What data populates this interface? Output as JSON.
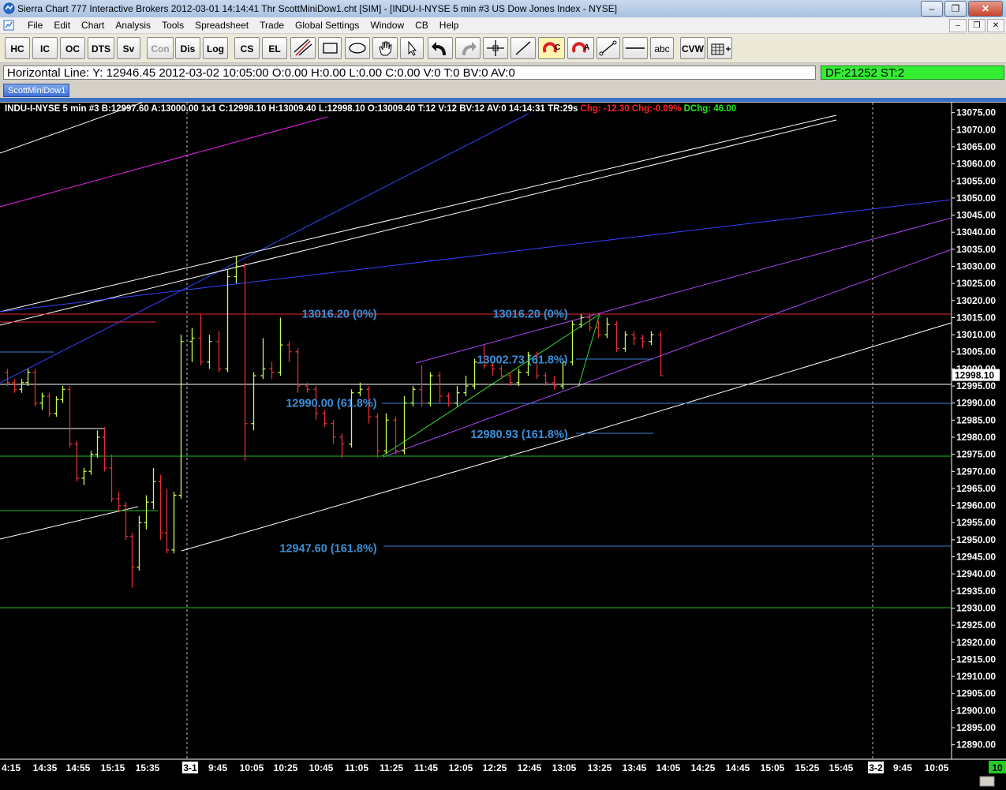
{
  "window": {
    "title": "Sierra Chart 777 Interactive Brokers 2012-03-01  14:14:41 Thr  ScottMiniDow1.cht [SIM] - [INDU-I-NYSE  5 min   #3  US Dow Jones Index - NYSE]",
    "minimize": "–",
    "maximize": "❐",
    "close": "✕"
  },
  "menu": {
    "items": [
      "File",
      "Edit",
      "Chart",
      "Analysis",
      "Tools",
      "Spreadsheet",
      "Trade",
      "Global Settings",
      "Window",
      "CB",
      "Help"
    ],
    "mdi_minimize": "–",
    "mdi_restore": "❐",
    "mdi_close": "✕"
  },
  "toolbar": {
    "buttons": [
      "HC",
      "IC",
      "OC",
      "DTS",
      "Sv",
      "Con",
      "Dis",
      "Log",
      "CS",
      "EL",
      "abc",
      "CVW"
    ]
  },
  "status": {
    "horizontal_line": "Horizontal Line: Y: 12946.45  2012-03-02  10:05:00  O:0.00  H:0.00  L:0.00  C:0.00  V:0  T:0  BV:0  AV:0",
    "df": "DF:21252  ST:2"
  },
  "chart_tab": "ScottMiniDow1",
  "chart_header": {
    "main": "INDU-I-NYSE  5 min   #3 B:12997.60 A:13000.00  1x1  C:12998.10  H:13009.40  L:12998.10  O:13009.40  T:12  V:12  BV:12  AV:0  14:14:31  TR:29s",
    "chg": "Chg: -12.30",
    "chg_pct": "Chg:-0.09%",
    "dchg": "DChg: 46.00"
  },
  "colors": {
    "up_bar": "#c8ff50",
    "down_bar": "#e03030",
    "fib_text": "#3a8fd8",
    "price_marker_bg": "#ffffff"
  },
  "chart_data": {
    "type": "bar",
    "ylim": [
      12886,
      13077
    ],
    "y_ticks": [
      13075,
      13070,
      13065,
      13060,
      13055,
      13050,
      13045,
      13040,
      13035,
      13030,
      13025,
      13020,
      13015,
      13010,
      13005,
      13000,
      12995,
      12990,
      12985,
      12980,
      12975,
      12970,
      12965,
      12960,
      12955,
      12950,
      12945,
      12940,
      12935,
      12930,
      12925,
      12920,
      12915,
      12910,
      12905,
      12900,
      12895,
      12890
    ],
    "x_ticks": [
      "4:15",
      "14:35",
      "14:55",
      "15:15",
      "15:35",
      "3-1",
      "9:45",
      "10:05",
      "10:25",
      "10:45",
      "11:05",
      "11:25",
      "11:45",
      "12:05",
      "12:25",
      "12:45",
      "13:05",
      "13:25",
      "13:45",
      "14:05",
      "14:25",
      "14:45",
      "15:05",
      "15:25",
      "15:45",
      "3-2",
      "9:45",
      "10:05"
    ],
    "last_price": "12998.10",
    "bottom_right_badge": "10",
    "fib_labels": [
      {
        "text": "13016.20 (0%)",
        "price": 13016.2
      },
      {
        "text": "13016.20 (0%)",
        "price": 13016.2
      },
      {
        "text": "13002.73 (61.8%)",
        "price": 13002.73
      },
      {
        "text": "12990.00 (61.8%)",
        "price": 12990.0
      },
      {
        "text": "12980.93 (161.8%)",
        "price": 12980.93
      },
      {
        "text": "12947.60 (161.8%)",
        "price": 12947.6
      }
    ],
    "bars": [
      {
        "o": 12999,
        "h": 13000,
        "l": 12995,
        "c": 12996
      },
      {
        "o": 12996,
        "h": 12997,
        "l": 12993,
        "c": 12994
      },
      {
        "o": 12994,
        "h": 12997,
        "l": 12993,
        "c": 12996
      },
      {
        "o": 12996,
        "h": 13000,
        "l": 12995,
        "c": 12999
      },
      {
        "o": 12999,
        "h": 13000,
        "l": 12989,
        "c": 12990
      },
      {
        "o": 12990,
        "h": 12993,
        "l": 12988,
        "c": 12992
      },
      {
        "o": 12992,
        "h": 12993,
        "l": 12986,
        "c": 12987
      },
      {
        "o": 12987,
        "h": 12992,
        "l": 12986,
        "c": 12991
      },
      {
        "o": 12991,
        "h": 12995,
        "l": 12990,
        "c": 12994
      },
      {
        "o": 12994,
        "h": 12995,
        "l": 12977,
        "c": 12978
      },
      {
        "o": 12978,
        "h": 12979,
        "l": 12967,
        "c": 12968
      },
      {
        "o": 12968,
        "h": 12971,
        "l": 12966,
        "c": 12970
      },
      {
        "o": 12970,
        "h": 12976,
        "l": 12969,
        "c": 12975
      },
      {
        "o": 12975,
        "h": 12982,
        "l": 12974,
        "c": 12980
      },
      {
        "o": 12980,
        "h": 12983,
        "l": 12970,
        "c": 12971
      },
      {
        "o": 12971,
        "h": 12975,
        "l": 12961,
        "c": 12962
      },
      {
        "o": 12962,
        "h": 12964,
        "l": 12958,
        "c": 12960
      },
      {
        "o": 12960,
        "h": 12961,
        "l": 12950,
        "c": 12951
      },
      {
        "o": 12951,
        "h": 12952,
        "l": 12936,
        "c": 12942
      },
      {
        "o": 12942,
        "h": 12957,
        "l": 12941,
        "c": 12955
      },
      {
        "o": 12955,
        "h": 12963,
        "l": 12953,
        "c": 12961
      },
      {
        "o": 12961,
        "h": 12971,
        "l": 12959,
        "c": 12967
      },
      {
        "o": 12967,
        "h": 12969,
        "l": 12950,
        "c": 12952
      },
      {
        "o": 12952,
        "h": 12965,
        "l": 12946,
        "c": 12947
      },
      {
        "o": 12947,
        "h": 12964,
        "l": 12946,
        "c": 12963
      },
      {
        "o": 12963,
        "h": 13010,
        "l": 12962,
        "c": 13008
      },
      {
        "o": 13008,
        "h": 13012,
        "l": 13002,
        "c": 13009
      },
      {
        "o": 13009,
        "h": 13016,
        "l": 13001,
        "c": 13002
      },
      {
        "o": 13002,
        "h": 13010,
        "l": 13000,
        "c": 13008
      },
      {
        "o": 13008,
        "h": 13011,
        "l": 12999,
        "c": 13000
      },
      {
        "o": 13000,
        "h": 13029,
        "l": 12999,
        "c": 13027
      },
      {
        "o": 13027,
        "h": 13033,
        "l": 13025,
        "c": 13030
      },
      {
        "o": 13030,
        "h": 13031,
        "l": 12973,
        "c": 12984
      },
      {
        "o": 12984,
        "h": 12999,
        "l": 12982,
        "c": 12998
      },
      {
        "o": 12998,
        "h": 13009,
        "l": 12997,
        "c": 13000
      },
      {
        "o": 13000,
        "h": 13002,
        "l": 12997,
        "c": 12999
      },
      {
        "o": 12999,
        "h": 13015,
        "l": 12998,
        "c": 13007
      },
      {
        "o": 13007,
        "h": 13008,
        "l": 13002,
        "c": 13005
      },
      {
        "o": 13005,
        "h": 13006,
        "l": 12993,
        "c": 12995
      },
      {
        "o": 12995,
        "h": 12996,
        "l": 12993,
        "c": 12994
      },
      {
        "o": 12994,
        "h": 12995,
        "l": 12985,
        "c": 12987
      },
      {
        "o": 12987,
        "h": 12988,
        "l": 12983,
        "c": 12984
      },
      {
        "o": 12984,
        "h": 12985,
        "l": 12978,
        "c": 12980
      },
      {
        "o": 12980,
        "h": 12981,
        "l": 12974,
        "c": 12978
      },
      {
        "o": 12978,
        "h": 12994,
        "l": 12977,
        "c": 12993
      },
      {
        "o": 12993,
        "h": 12996,
        "l": 12992,
        "c": 12994
      },
      {
        "o": 12994,
        "h": 12995,
        "l": 12984,
        "c": 12986
      },
      {
        "o": 12986,
        "h": 12987,
        "l": 12974,
        "c": 12976
      },
      {
        "o": 12976,
        "h": 12987,
        "l": 12975,
        "c": 12985
      },
      {
        "o": 12985,
        "h": 12986,
        "l": 12975,
        "c": 12976
      },
      {
        "o": 12976,
        "h": 12992,
        "l": 12975,
        "c": 12990
      },
      {
        "o": 12990,
        "h": 12995,
        "l": 12989,
        "c": 12994
      },
      {
        "o": 12994,
        "h": 13001,
        "l": 12989,
        "c": 12990
      },
      {
        "o": 12990,
        "h": 12999,
        "l": 12989,
        "c": 12998
      },
      {
        "o": 12998,
        "h": 12999,
        "l": 12990,
        "c": 12992
      },
      {
        "o": 12992,
        "h": 12993,
        "l": 12989,
        "c": 12990
      },
      {
        "o": 12990,
        "h": 12995,
        "l": 12989,
        "c": 12993
      },
      {
        "o": 12993,
        "h": 12998,
        "l": 12992,
        "c": 12995
      },
      {
        "o": 12995,
        "h": 13003,
        "l": 12994,
        "c": 13002
      },
      {
        "o": 13002,
        "h": 13007,
        "l": 13000,
        "c": 13001
      },
      {
        "o": 13001,
        "h": 13002,
        "l": 12998,
        "c": 13000
      },
      {
        "o": 13000,
        "h": 13001,
        "l": 12997,
        "c": 12998
      },
      {
        "o": 12998,
        "h": 12999,
        "l": 12995,
        "c": 12996
      },
      {
        "o": 12996,
        "h": 13000,
        "l": 12995,
        "c": 12999
      },
      {
        "o": 12999,
        "h": 13005,
        "l": 12998,
        "c": 13004
      },
      {
        "o": 13004,
        "h": 13005,
        "l": 12997,
        "c": 12998
      },
      {
        "o": 12998,
        "h": 12999,
        "l": 12995,
        "c": 12996
      },
      {
        "o": 12996,
        "h": 12998,
        "l": 12994,
        "c": 12995
      },
      {
        "o": 12995,
        "h": 13003,
        "l": 12994,
        "c": 13002
      },
      {
        "o": 13002,
        "h": 13014,
        "l": 13001,
        "c": 13013
      },
      {
        "o": 13013,
        "h": 13016,
        "l": 13012,
        "c": 13015
      },
      {
        "o": 13015,
        "h": 13016,
        "l": 13011,
        "c": 13012
      },
      {
        "o": 13012,
        "h": 13014,
        "l": 13009,
        "c": 13010
      },
      {
        "o": 13010,
        "h": 13015,
        "l": 13009,
        "c": 13013
      },
      {
        "o": 13013,
        "h": 13014,
        "l": 13005,
        "c": 13006
      },
      {
        "o": 13006,
        "h": 13011,
        "l": 13005,
        "c": 13010
      },
      {
        "o": 13010,
        "h": 13011,
        "l": 13007,
        "c": 13009
      },
      {
        "o": 13009,
        "h": 13010,
        "l": 13006,
        "c": 13008
      },
      {
        "o": 13008,
        "h": 13011,
        "l": 13007,
        "c": 13010
      },
      {
        "o": 13010,
        "h": 13011,
        "l": 12998,
        "c": 12998
      }
    ]
  }
}
